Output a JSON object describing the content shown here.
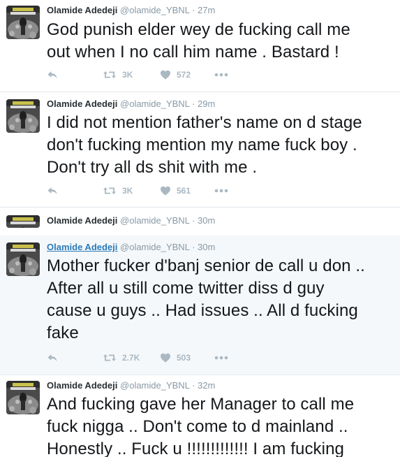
{
  "tweets": [
    {
      "name": "Olamide Adedeji",
      "handle": "@olamide_YBNL",
      "separator": "·",
      "time": "27m",
      "text": "God punish elder wey de fucking call me\nout when I no call him name . Bastard !",
      "retweets": "3K",
      "likes": "572"
    },
    {
      "name": "Olamide Adedeji",
      "handle": "@olamide_YBNL",
      "separator": "·",
      "time": "29m",
      "text": "I did not mention father's name on d stage\ndon't fucking mention my name fuck boy .\nDon't try all ds shit with me .",
      "retweets": "3K",
      "likes": "561"
    },
    {
      "name": "Olamide Adedeji",
      "handle": "@olamide_YBNL",
      "separator": "·",
      "time": "30m"
    },
    {
      "name": "Olamide Adedeji",
      "handle": "@olamide_YBNL",
      "separator": "·",
      "time": "30m",
      "text": "Mother fucker d'banj senior de call u don ..\nAfter all u still come twitter diss d guy\ncause u guys .. Had issues .. All d fucking\nfake",
      "retweets": "2.7K",
      "likes": "503"
    },
    {
      "name": "Olamide Adedeji",
      "handle": "@olamide_YBNL",
      "separator": "·",
      "time": "32m",
      "text": "And fucking gave her Manager to call me\nfuck nigga .. Don't come to d mainland ..\nHonestly .. Fuck u !!!!!!!!!!!!! I am fucking"
    }
  ],
  "colors": {
    "text": "#14171a",
    "meta": "#8899a6",
    "icon": "#aab8c2",
    "link": "#2b7bb9",
    "hover_bg": "#f5f8fa",
    "border": "#e1e8ed"
  },
  "icons": [
    "reply-icon",
    "retweet-icon",
    "like-icon",
    "more-icon"
  ]
}
